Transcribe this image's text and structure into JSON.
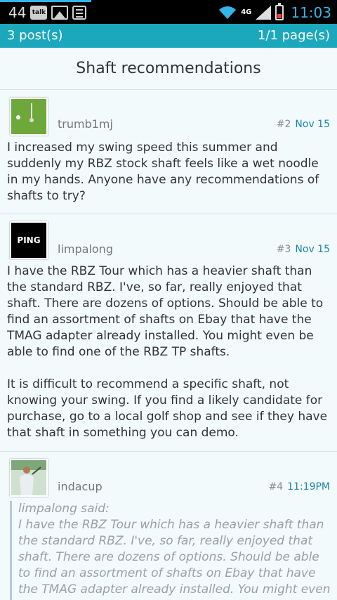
{
  "status_bar": {
    "left_number": "44",
    "talk_label": "talk",
    "network": "4G",
    "time": "11:03"
  },
  "header": {
    "posts": "3 post(s)",
    "pages": "1/1 page(s)"
  },
  "thread": {
    "title": "Shaft recommendations"
  },
  "posts": [
    {
      "author": "trumb1mj",
      "number": "#2",
      "date": "Nov 15",
      "avatar_icon": "golf-ball-avatar",
      "body": [
        "I increased my swing speed this summer and suddenly my RBZ stock shaft feels like a wet noodle in my hands. Anyone have any recommendations of shafts to try?"
      ]
    },
    {
      "author": "limpalong",
      "number": "#3",
      "date": "Nov 15",
      "avatar_icon": "ping-logo-avatar",
      "avatar_text": "PING",
      "body": [
        "I have the RBZ Tour which has a heavier shaft than the standard RBZ. I've, so far, really enjoyed that shaft. There are dozens of options. Should be able to find an assortment of shafts on Ebay that have the TMAG adapter already installed. You might even be able to find one of the RBZ TP shafts.",
        "It is difficult to recommend a specific shaft, not knowing your swing. If you find a likely candidate for purchase, go to a local golf shop and see if they have that shaft in something you can demo."
      ]
    },
    {
      "author": "indacup",
      "number": "#4",
      "date": "11:19PM",
      "avatar_icon": "golfer-photo-avatar",
      "quote_author": "limpalong said:",
      "quote_text": "I have the RBZ Tour which has a heavier shaft than the standard RBZ. I've, so far, really enjoyed that shaft. There are dozens of options. Should be able to find an assortment of shafts on Ebay that have the TMAG adapter already installed. You might even be"
    }
  ]
}
